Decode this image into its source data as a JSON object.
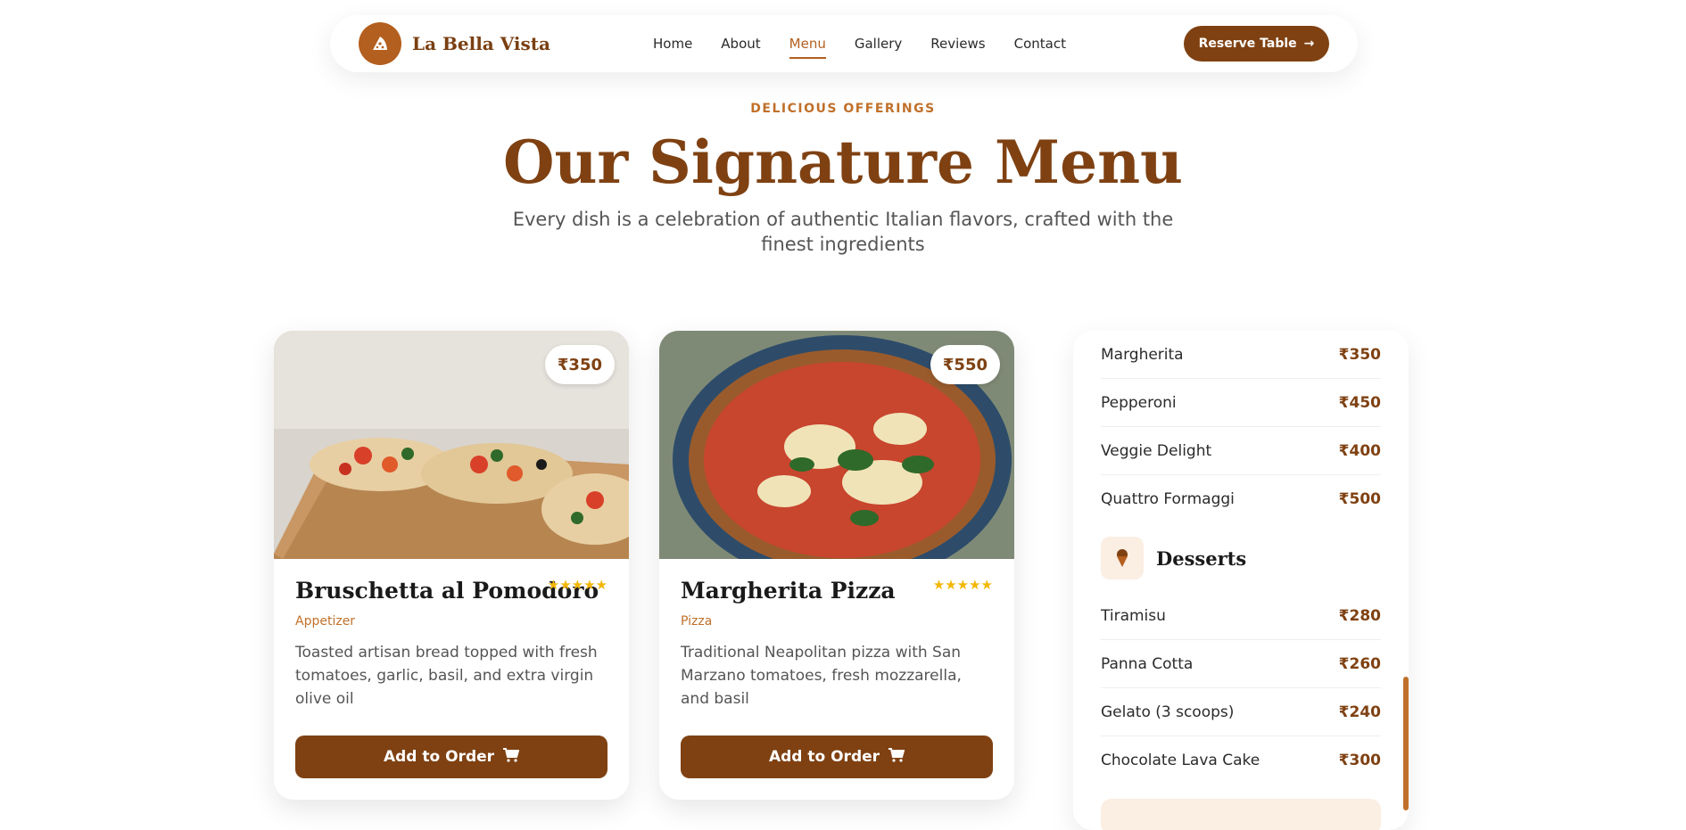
{
  "header": {
    "brand": "La Bella Vista",
    "nav": [
      "Home",
      "About",
      "Menu",
      "Gallery",
      "Reviews",
      "Contact"
    ],
    "active_nav": "Menu",
    "reserve_label": "Reserve Table"
  },
  "hero": {
    "eyebrow": "DELICIOUS OFFERINGS",
    "title": "Our Signature Menu",
    "subtitle": "Every dish is a celebration of authentic Italian flavors, crafted with the finest ingredients"
  },
  "cards": [
    {
      "name": "Bruschetta al Pomodoro",
      "price": "₹350",
      "category": "Appetizer",
      "rating": 5,
      "stars": "★★★★★",
      "description": "Toasted artisan bread topped with fresh tomatoes, garlic, basil, and extra virgin olive oil",
      "button": "Add to Order"
    },
    {
      "name": "Margherita Pizza",
      "price": "₹550",
      "category": "Pizza",
      "rating": 5,
      "stars": "★★★★★",
      "description": "Traditional Neapolitan pizza with San Marzano tomatoes, fresh mozzarella, and basil",
      "button": "Add to Order"
    }
  ],
  "menu_panel": {
    "pizza_items": [
      {
        "name": "Margherita",
        "price": "₹350"
      },
      {
        "name": "Pepperoni",
        "price": "₹450"
      },
      {
        "name": "Veggie Delight",
        "price": "₹400"
      },
      {
        "name": "Quattro Formaggi",
        "price": "₹500"
      }
    ],
    "desserts_title": "Desserts",
    "dessert_items": [
      {
        "name": "Tiramisu",
        "price": "₹280"
      },
      {
        "name": "Panna Cotta",
        "price": "₹260"
      },
      {
        "name": "Gelato (3 scoops)",
        "price": "₹240"
      },
      {
        "name": "Chocolate Lava Cake",
        "price": "₹300"
      }
    ]
  },
  "colors": {
    "brand": "#7f4112",
    "accent": "#c0702a",
    "star": "#f2b705"
  }
}
